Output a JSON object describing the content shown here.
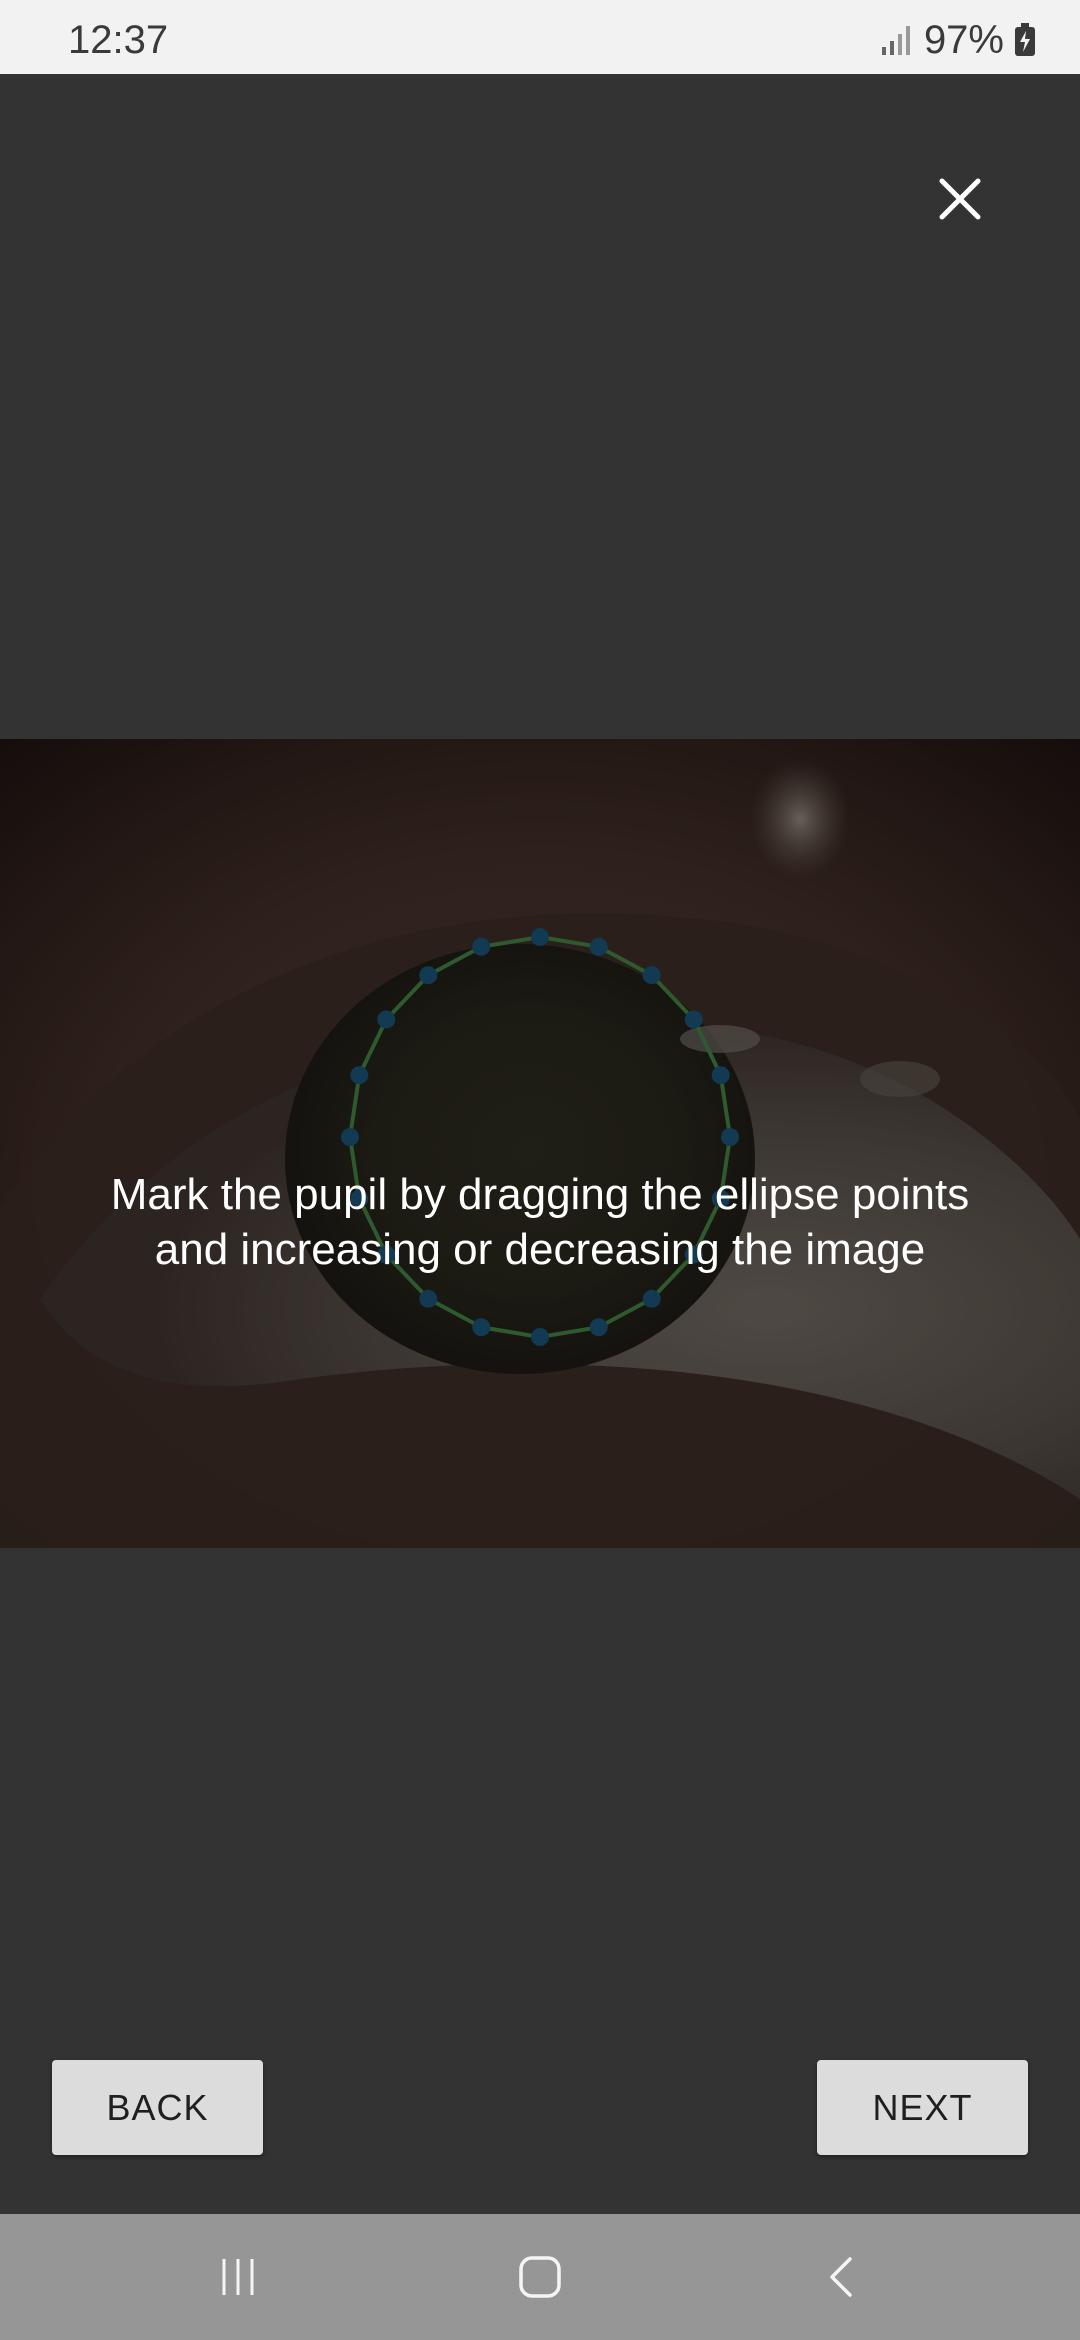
{
  "status_bar": {
    "time": "12:37",
    "battery": "97%",
    "icons": [
      "signal-icon",
      "battery-charging-icon"
    ]
  },
  "dialog": {
    "close_icon": "close-icon",
    "instruction": "Mark the pupil by dragging the ellipse points\nand increasing or decreasing the image"
  },
  "buttons": {
    "back_label": "BACK",
    "next_label": "NEXT"
  },
  "nav_bar": {
    "icons": [
      "recents-icon",
      "home-icon",
      "back-icon"
    ]
  },
  "colors": {
    "background": "#333333",
    "ellipse_line": "#2e5a2e",
    "ellipse_point": "#123a52",
    "button": "#dcdcdc"
  }
}
